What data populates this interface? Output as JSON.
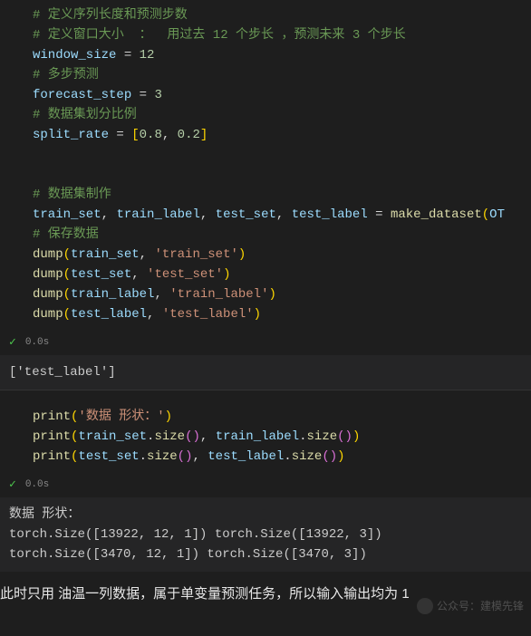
{
  "cell1": {
    "c1": "# 定义序列长度和预测步数",
    "c2": "# 定义窗口大小  ：  用过去 12 个步长 ，预测未来 3 个步长",
    "window_var": "window_size",
    "eq": " = ",
    "window_val": "12",
    "c3": "# 多步预测",
    "forecast_var": "forecast_step",
    "forecast_val": "3",
    "c4": "# 数据集划分比例",
    "split_var": "split_rate",
    "lb": "[",
    "sv1": "0.8",
    "comma": ", ",
    "sv2": "0.2",
    "rb": "]",
    "c5": "# 数据集制作",
    "train_set": "train_set",
    "train_label": "train_label",
    "test_set": "test_set",
    "test_label": "test_label",
    "make_fn": "make_dataset",
    "make_arg": "OT",
    "c6": "# 保存数据",
    "dump": "dump",
    "s_train_set": "'train_set'",
    "s_test_set": "'test_set'",
    "s_train_label": "'train_label'",
    "s_test_label": "'test_label'",
    "lp": "(",
    "rp": ")"
  },
  "status": {
    "time": "0.0s"
  },
  "out1": "['test_label']",
  "cell2": {
    "print": "print",
    "shape_label": "'数据 形状：'",
    "size": "size",
    "dot": ".",
    "train_set": "train_set",
    "train_label": "train_label",
    "test_set": "test_set",
    "test_label": "test_label",
    "lp": "(",
    "rp": ")",
    "ilp": "(",
    "irp": ")",
    "comma": ", "
  },
  "out2": {
    "l1": "数据 形状：",
    "l2": "torch.Size([13922, 12, 1]) torch.Size([13922, 3])",
    "l3": "torch.Size([3470, 12, 1]) torch.Size([3470, 3])"
  },
  "bottom": "此时只用 油温一列数据，属于单变量预测任务，所以输入输出均为 1",
  "watermark": "公众号：建模先锋"
}
